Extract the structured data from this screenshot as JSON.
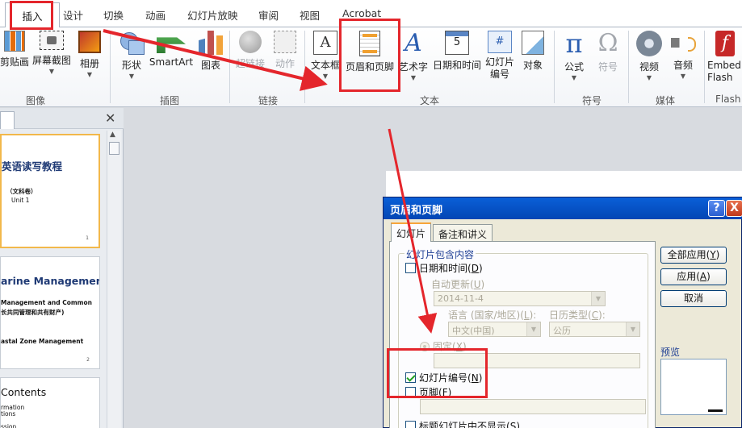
{
  "tabs": [
    {
      "label": "插入",
      "active": true
    },
    {
      "label": "设计"
    },
    {
      "label": "切换"
    },
    {
      "label": "动画"
    },
    {
      "label": "幻灯片放映"
    },
    {
      "label": "审阅"
    },
    {
      "label": "视图"
    },
    {
      "label": "Acrobat"
    }
  ],
  "ribbon": {
    "images": {
      "clip": "剪贴画",
      "screenshot": "屏幕截图",
      "album": "相册",
      "group": "图像"
    },
    "illustrations": {
      "shapes": "形状",
      "smartart": "SmartArt",
      "chart": "图表",
      "group": "插图"
    },
    "links": {
      "hyperlink": "超链接",
      "action": "动作",
      "group": "链接"
    },
    "text": {
      "textbox": "文本框",
      "header_footer": "页眉和页脚",
      "wordart": "艺术字",
      "datetime": "日期和时间",
      "slide_number_1": "幻灯片",
      "slide_number_2": "编号",
      "object": "对象",
      "group": "文本",
      "date_digit": "5",
      "num_glyph": "#"
    },
    "symbols": {
      "equation": "公式",
      "symbol": "符号",
      "group": "符号",
      "pi": "π",
      "omega": "Ω"
    },
    "media": {
      "video": "视频",
      "audio": "音频",
      "group": "媒体"
    },
    "flash": {
      "embed_1": "Embed",
      "embed_2": "Flash",
      "group": "Flash"
    },
    "textbox_glyph": "A",
    "wordart_glyph": "A"
  },
  "slides": [
    {
      "title": "英语读写教程",
      "lines": [
        "（文科卷）",
        "Unit 1"
      ],
      "num": "1"
    },
    {
      "title": "arine Management",
      "lines": [
        "Management and Common",
        "长共同管理和共有财产)",
        "astal Zone Management"
      ],
      "num": "2"
    },
    {
      "title": "Contents",
      "lines": [
        "rmation",
        "tions",
        "ssion"
      ],
      "num": ""
    }
  ],
  "dialog": {
    "title": "页眉和页脚",
    "help": "?",
    "close": "X",
    "tabs": [
      "幻灯片",
      "备注和讲义"
    ],
    "section_label": "幻灯片包含内容",
    "datetime_label": "日期和时间",
    "datetime_key": "D",
    "datetime_checked": false,
    "auto_update_label": "自动更新",
    "auto_update_key": "U",
    "date_value": "2014-11-4",
    "language_label": "语言 (国家/地区)",
    "language_key": "L",
    "calendar_label": "日历类型",
    "calendar_key": "C",
    "language_value": "中文(中国)",
    "calendar_value": "公历",
    "fixed_label": "固定",
    "fixed_key": "X",
    "slide_number_label": "幻灯片编号",
    "slide_number_key": "N",
    "slide_number_checked": true,
    "footer_label": "页脚",
    "footer_key": "F",
    "footer_checked": false,
    "hide_title_label": "标题幻灯片中不显示",
    "hide_title_key": "S",
    "apply_all": "全部应用",
    "apply_all_key": "Y",
    "apply": "应用",
    "apply_key": "A",
    "cancel": "取消",
    "preview_label": "预览"
  },
  "colors": {
    "annotation": "#e4262c",
    "dialog_title": "#0346b4",
    "slide_title": "#1f3a75",
    "selected_slide_border": "#f2b84b"
  }
}
